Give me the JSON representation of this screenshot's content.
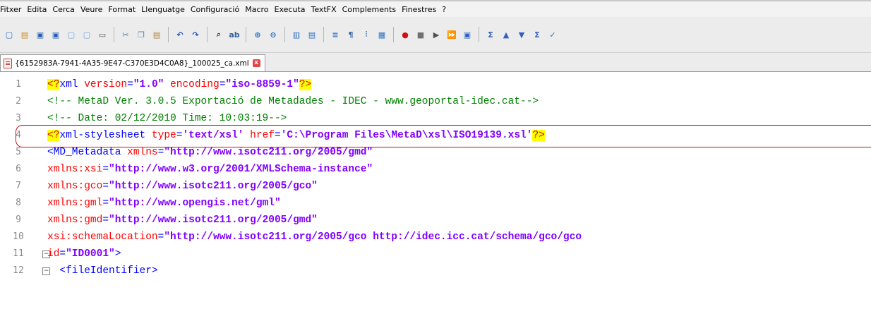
{
  "menu": [
    "Fitxer",
    "Edita",
    "Cerca",
    "Veure",
    "Format",
    "Llenguatge",
    "Configuració",
    "Macro",
    "Executa",
    "TextFX",
    "Complements",
    "Finestres",
    "?"
  ],
  "toolbar": {
    "icons": [
      {
        "name": "new-file-icon",
        "glyph": "▢",
        "color": "#2b6cc4"
      },
      {
        "name": "open-file-icon",
        "glyph": "▤",
        "color": "#d08b1c"
      },
      {
        "name": "save-icon",
        "glyph": "▣",
        "color": "#2b5fb4"
      },
      {
        "name": "save-all-icon",
        "glyph": "▣",
        "color": "#2b5fb4"
      },
      {
        "name": "close-file-icon",
        "glyph": "▢",
        "color": "#6aa0e0"
      },
      {
        "name": "close-all-icon",
        "glyph": "▢",
        "color": "#6aa0e0"
      },
      {
        "name": "print-icon",
        "glyph": "▭",
        "color": "#555555"
      },
      {
        "sep": true
      },
      {
        "name": "cut-icon",
        "glyph": "✂",
        "color": "#6080a0"
      },
      {
        "name": "copy-icon",
        "glyph": "❐",
        "color": "#6080a0"
      },
      {
        "name": "paste-icon",
        "glyph": "▤",
        "color": "#b08030"
      },
      {
        "sep": true
      },
      {
        "name": "undo-icon",
        "glyph": "↶",
        "color": "#2050c0"
      },
      {
        "name": "redo-icon",
        "glyph": "↷",
        "color": "#2050c0"
      },
      {
        "sep": true
      },
      {
        "name": "find-icon",
        "glyph": "⌕",
        "color": "#404040"
      },
      {
        "name": "replace-icon",
        "glyph": "ab",
        "color": "#3060a0"
      },
      {
        "sep": true
      },
      {
        "name": "zoom-in-icon",
        "glyph": "⊕",
        "color": "#3070c0"
      },
      {
        "name": "zoom-out-icon",
        "glyph": "⊖",
        "color": "#3070c0"
      },
      {
        "sep": true
      },
      {
        "name": "sync-vertical-icon",
        "glyph": "▥",
        "color": "#3070c0"
      },
      {
        "name": "sync-horizontal-icon",
        "glyph": "▤",
        "color": "#3070c0"
      },
      {
        "sep": true
      },
      {
        "name": "word-wrap-icon",
        "glyph": "≡",
        "color": "#3070c0"
      },
      {
        "name": "show-all-chars-icon",
        "glyph": "¶",
        "color": "#3060a0"
      },
      {
        "name": "indent-guide-icon",
        "glyph": "⫶",
        "color": "#3070c0"
      },
      {
        "name": "user-language-icon",
        "glyph": "▦",
        "color": "#3070c0"
      },
      {
        "sep": true
      },
      {
        "name": "record-macro-icon",
        "glyph": "●",
        "color": "#d01010"
      },
      {
        "name": "stop-record-icon",
        "glyph": "■",
        "color": "#707070"
      },
      {
        "name": "play-macro-icon",
        "glyph": "▶",
        "color": "#505050"
      },
      {
        "name": "run-macro-multiple-icon",
        "glyph": "⏩",
        "color": "#3060c0"
      },
      {
        "name": "save-macro-icon",
        "glyph": "▣",
        "color": "#3060c0"
      },
      {
        "sep": true
      },
      {
        "name": "textfx-sum-icon",
        "glyph": "Σ",
        "color": "#3060c0"
      },
      {
        "name": "move-up-icon",
        "glyph": "▲",
        "color": "#3060c0"
      },
      {
        "name": "move-down-icon",
        "glyph": "▼",
        "color": "#3060c0"
      },
      {
        "name": "textfx-sort-icon",
        "glyph": "Σ",
        "color": "#3060c0"
      },
      {
        "name": "spell-check-icon",
        "glyph": "✓",
        "color": "#3070b0"
      }
    ]
  },
  "tab": {
    "label": "{6152983A-7941-4A35-9E47-C370E3D4C0A8}_100025_ca.xml",
    "close": "x"
  },
  "editor": {
    "lines": [
      {
        "n": "1",
        "fold": "",
        "parts": [
          [
            "pi",
            "<?"
          ],
          [
            "tag",
            "xml"
          ],
          [
            "attr",
            " version"
          ],
          [
            "punct",
            "="
          ],
          [
            "val",
            "\"1.0\""
          ],
          [
            "attr",
            " encoding"
          ],
          [
            "punct",
            "="
          ],
          [
            "val",
            "\"iso-8859-1\""
          ],
          [
            "pi",
            "?>"
          ]
        ]
      },
      {
        "n": "2",
        "fold": "",
        "parts": [
          [
            "comment",
            "<!-- MetaD Ver. 3.0.5 Exportació de Metadades - IDEC - www.geoportal-idec.cat-->"
          ]
        ]
      },
      {
        "n": "3",
        "fold": "",
        "parts": [
          [
            "comment",
            "<!-- Date: 02/12/2010 Time: 10:03:19-->"
          ]
        ]
      },
      {
        "n": "4",
        "fold": "",
        "parts": [
          [
            "pi",
            "<?"
          ],
          [
            "tag",
            "xml-stylesheet"
          ],
          [
            "attr",
            " type"
          ],
          [
            "punct",
            "="
          ],
          [
            "val",
            "'text/xsl'"
          ],
          [
            "attr",
            " href"
          ],
          [
            "punct",
            "="
          ],
          [
            "val",
            "'C:\\Program Files\\MetaD\\xsl\\ISO19139.xsl'"
          ],
          [
            "pi",
            "?>"
          ]
        ]
      },
      {
        "n": "5",
        "fold": "",
        "parts": [
          [
            "tag",
            "<MD_Metadata"
          ],
          [
            "attr",
            " xmlns"
          ],
          [
            "punct",
            "="
          ],
          [
            "val",
            "\"http://www.isotc211.org/2005/gmd\""
          ]
        ]
      },
      {
        "n": "6",
        "fold": "",
        "parts": [
          [
            "attr",
            "xmlns:xsi"
          ],
          [
            "punct",
            "="
          ],
          [
            "val",
            "\"http://www.w3.org/2001/XMLSchema-instance\""
          ]
        ]
      },
      {
        "n": "7",
        "fold": "",
        "parts": [
          [
            "attr",
            "xmlns:gco"
          ],
          [
            "punct",
            "="
          ],
          [
            "val",
            "\"http://www.isotc211.org/2005/gco\""
          ]
        ]
      },
      {
        "n": "8",
        "fold": "",
        "parts": [
          [
            "attr",
            "xmlns:gml"
          ],
          [
            "punct",
            "="
          ],
          [
            "val",
            "\"http://www.opengis.net/gml\""
          ]
        ]
      },
      {
        "n": "9",
        "fold": "",
        "parts": [
          [
            "attr",
            "xmlns:gmd"
          ],
          [
            "punct",
            "="
          ],
          [
            "val",
            "\"http://www.isotc211.org/2005/gmd\""
          ]
        ]
      },
      {
        "n": "10",
        "fold": "",
        "parts": [
          [
            "attr",
            "xsi:schemaLocation"
          ],
          [
            "punct",
            "="
          ],
          [
            "val",
            "\"http://www.isotc211.org/2005/gco http://idec.icc.cat/schema/gco/gco"
          ]
        ]
      },
      {
        "n": "11",
        "fold": "minus",
        "parts": [
          [
            "attr",
            "id"
          ],
          [
            "punct",
            "="
          ],
          [
            "val",
            "\"ID0001\""
          ],
          [
            "tag",
            ">"
          ]
        ]
      },
      {
        "n": "12",
        "fold": "minus",
        "parts": [
          [
            "tag",
            "  <fileIdentifier>"
          ]
        ]
      }
    ]
  }
}
